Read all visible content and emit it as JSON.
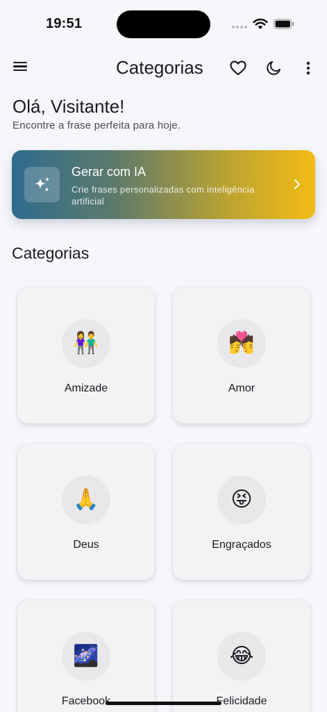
{
  "status_bar": {
    "time": "19:51"
  },
  "app_bar": {
    "title": "Categorias",
    "icons": [
      "menu-icon",
      "heart-icon",
      "moon-icon",
      "more-vert-icon"
    ]
  },
  "greeting": {
    "title": "Olá, Visitante!",
    "subtitle": "Encontre a frase perfeita para hoje."
  },
  "ai_card": {
    "title": "Gerar com IA",
    "description": "Crie frases personalizadas com inteligência artificial",
    "icon": "sparkles-icon",
    "gradient_start": "#2e6b8e",
    "gradient_end": "#f4bb14"
  },
  "categories": {
    "title": "Categorias",
    "items": [
      {
        "label": "Amizade",
        "emoji": "👫"
      },
      {
        "label": "Amor",
        "emoji": "💏"
      },
      {
        "label": "Deus",
        "emoji": "🙏"
      },
      {
        "label": "Engraçados",
        "emoji": "😝"
      },
      {
        "label": "Facebook",
        "emoji": "🌌"
      },
      {
        "label": "Felicidade",
        "emoji": "😂"
      }
    ]
  }
}
